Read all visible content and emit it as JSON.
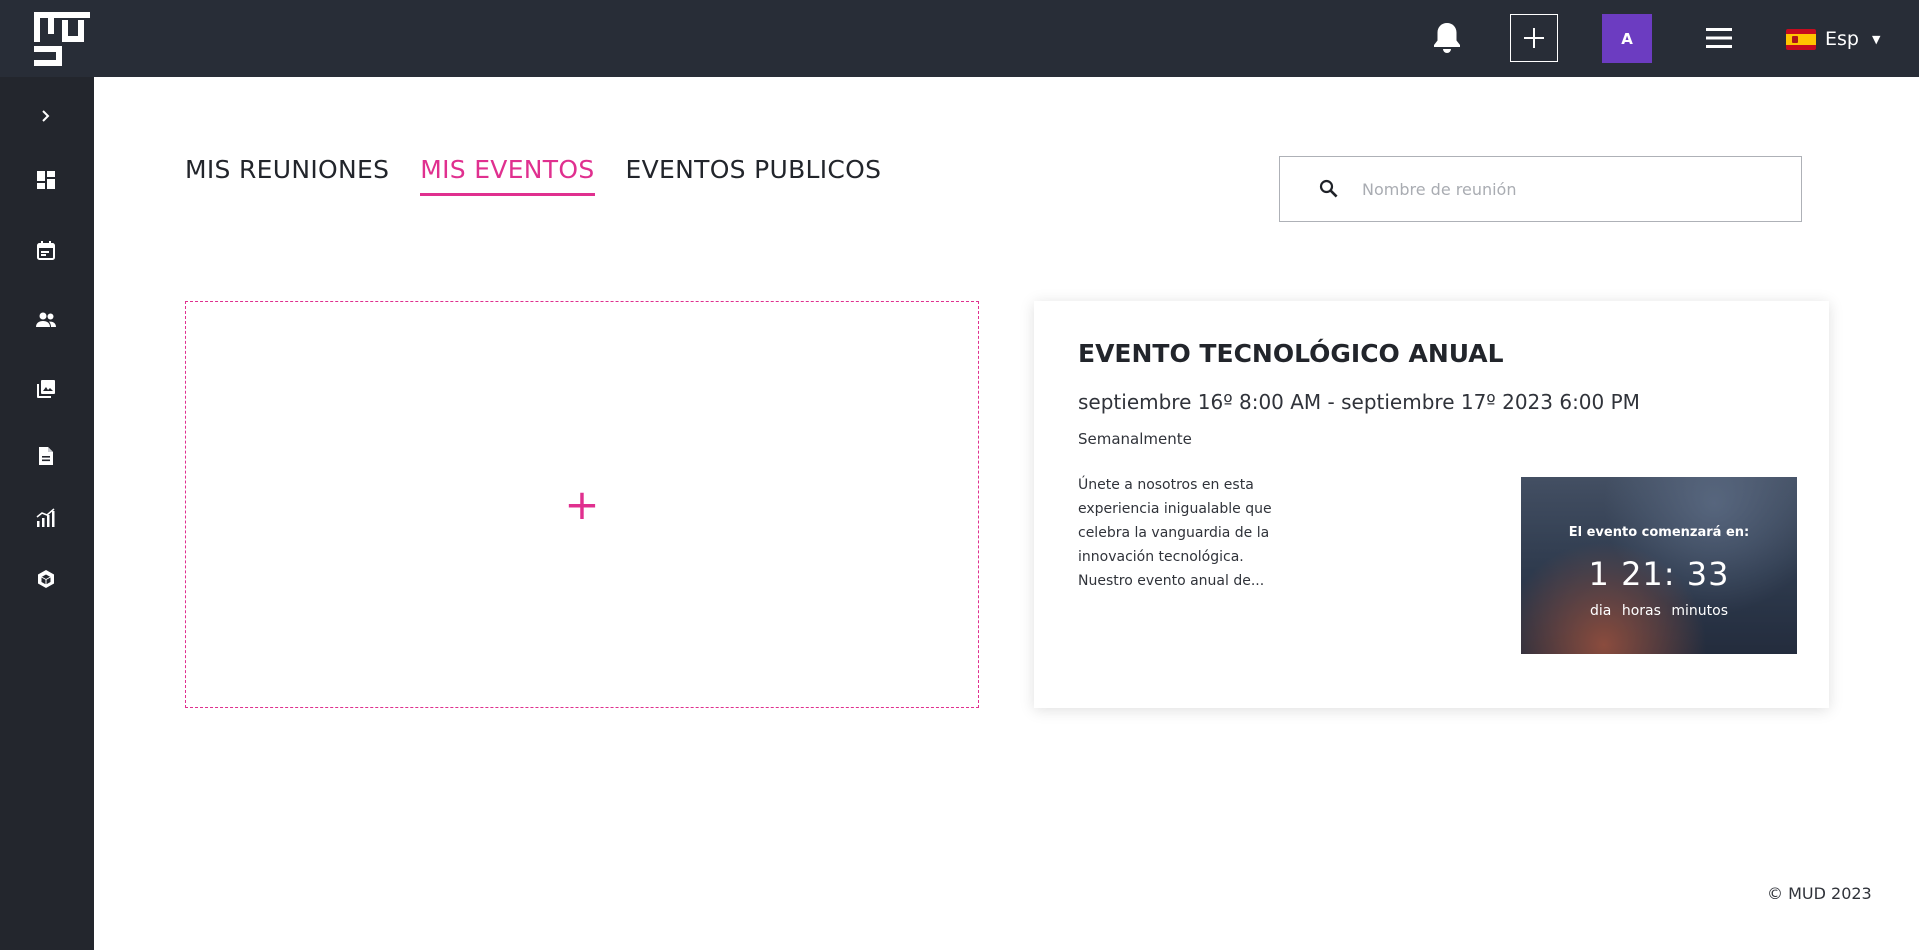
{
  "topbar": {
    "logo_icon": "mud-logo",
    "bell_icon": "bell-icon",
    "add_icon": "plus-icon",
    "avatar_initial": "A",
    "menu_icon": "hamburger-icon",
    "language": "Esp",
    "language_flag": "spain-flag"
  },
  "sidebar": {
    "items": [
      {
        "icon": "chevron-right-icon"
      },
      {
        "icon": "dashboard-icon"
      },
      {
        "icon": "calendar-icon"
      },
      {
        "icon": "users-icon"
      },
      {
        "icon": "gallery-icon"
      },
      {
        "icon": "document-icon"
      },
      {
        "icon": "analytics-icon"
      },
      {
        "icon": "cube-icon"
      }
    ]
  },
  "tabs": [
    {
      "label": "MIS REUNIONES",
      "active": false
    },
    {
      "label": "MIS EVENTOS",
      "active": true
    },
    {
      "label": "EVENTOS PUBLICOS",
      "active": false
    }
  ],
  "search": {
    "placeholder": "Nombre de reunión",
    "value": ""
  },
  "add_card": {
    "symbol": "+"
  },
  "event": {
    "title": "EVENTO TECNOLÓGICO ANUAL",
    "dates": "septiembre 16º 8:00 AM - septiembre 17º 2023 6:00 PM",
    "frequency": "Semanalmente",
    "description": "Únete a nosotros en esta experiencia inigualable que celebra la vanguardia de la innovación tecnológica. Nuestro evento anual de...",
    "countdown": {
      "label": "El evento comenzará en:",
      "numbers": "1  21: 33",
      "units": [
        "dia",
        "horas",
        "minutos"
      ]
    }
  },
  "footer": {
    "copyright": "© MUD 2023"
  },
  "colors": {
    "topbar_bg": "#282d37",
    "sidebar_bg": "#23262d",
    "accent": "#e0308f",
    "avatar_bg": "#6c3cc1"
  }
}
